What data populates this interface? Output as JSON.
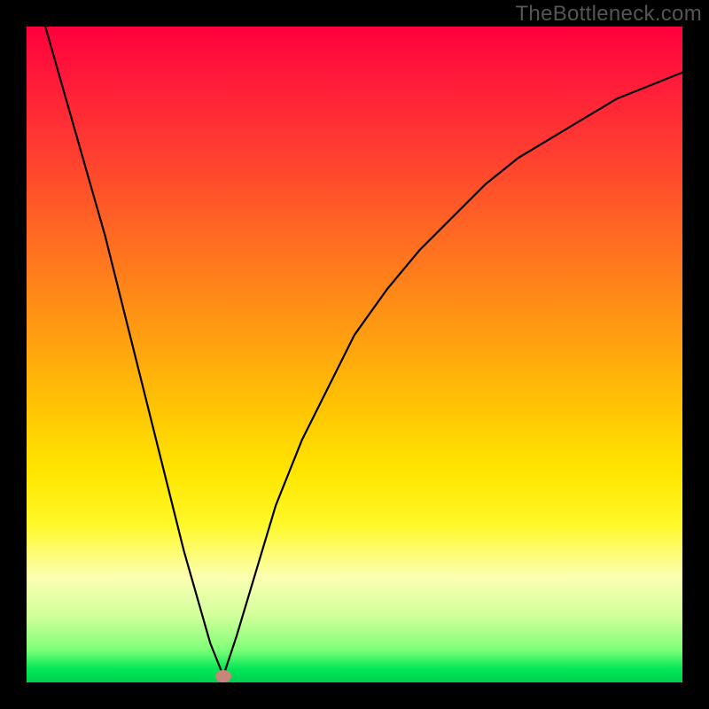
{
  "watermark": "TheBottleneck.com",
  "chart_data": {
    "type": "line",
    "title": "",
    "xlabel": "",
    "ylabel": "",
    "xlim": [
      0,
      1
    ],
    "ylim": [
      0,
      1
    ],
    "minimum_point": {
      "x": 0.3,
      "y": 0.01
    },
    "x": [
      0.0,
      0.02,
      0.04,
      0.06,
      0.08,
      0.1,
      0.12,
      0.14,
      0.16,
      0.18,
      0.2,
      0.22,
      0.24,
      0.26,
      0.28,
      0.3,
      0.32,
      0.35,
      0.38,
      0.42,
      0.46,
      0.5,
      0.55,
      0.6,
      0.65,
      0.7,
      0.75,
      0.8,
      0.85,
      0.9,
      0.95,
      1.0
    ],
    "values": [
      1.1,
      1.03,
      0.96,
      0.89,
      0.82,
      0.75,
      0.68,
      0.6,
      0.52,
      0.44,
      0.36,
      0.28,
      0.2,
      0.13,
      0.06,
      0.01,
      0.07,
      0.17,
      0.27,
      0.37,
      0.45,
      0.53,
      0.6,
      0.66,
      0.71,
      0.76,
      0.8,
      0.83,
      0.86,
      0.89,
      0.91,
      0.93
    ],
    "gradient_stops": [
      {
        "pos": 0.0,
        "color": "#ff003c"
      },
      {
        "pos": 0.18,
        "color": "#ff3a32"
      },
      {
        "pos": 0.46,
        "color": "#ff9a12"
      },
      {
        "pos": 0.68,
        "color": "#ffe600"
      },
      {
        "pos": 0.84,
        "color": "#fbffb3"
      },
      {
        "pos": 0.95,
        "color": "#7fff78"
      },
      {
        "pos": 1.0,
        "color": "#00d050"
      }
    ]
  }
}
